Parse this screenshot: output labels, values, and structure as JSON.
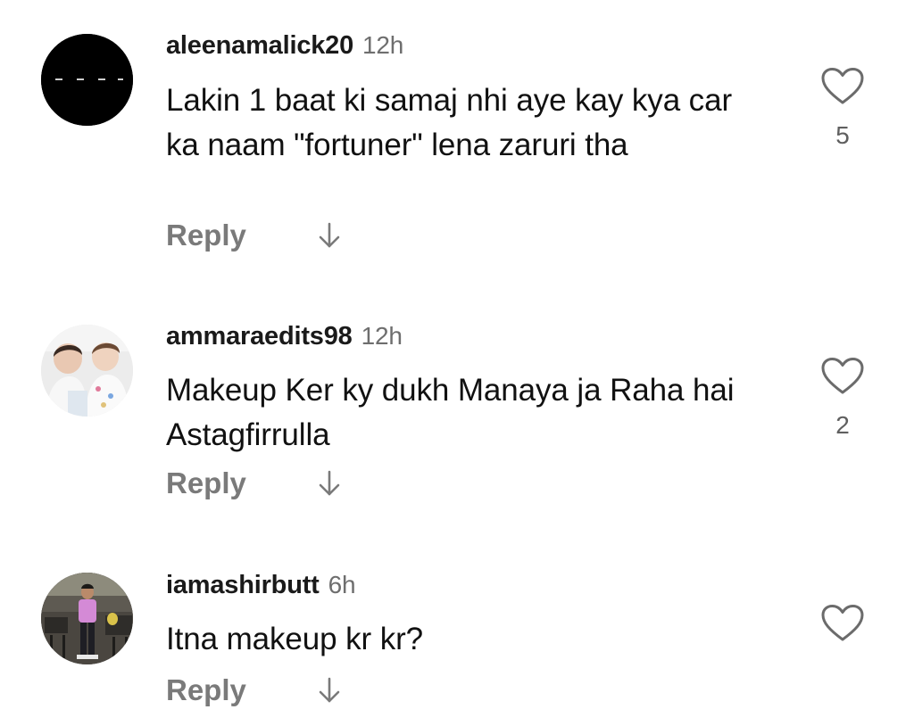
{
  "comments": [
    {
      "username": "aleenamalick20",
      "time": "12h",
      "text": "Lakin 1 baat ki samaj nhi aye kay kya car ka naam \"fortuner\" lena zaruri tha",
      "likes": "5",
      "reply_label": "Reply",
      "avatar": "black-circle-with-dashes"
    },
    {
      "username": "ammaraedits98",
      "time": "12h",
      "text": "Makeup Ker ky dukh Manaya ja Raha hai Astagfirrulla",
      "likes": "2",
      "reply_label": "Reply",
      "avatar": "two-children-photo"
    },
    {
      "username": "iamashirbutt",
      "time": "6h",
      "text": "Itna makeup kr kr?",
      "likes": "",
      "reply_label": "Reply",
      "avatar": "person-in-pink-shirt-photo"
    }
  ],
  "icons": {
    "like": "heart-outline-icon",
    "more_replies": "arrow-down-icon"
  },
  "colors": {
    "text": "#111111",
    "secondary": "#6e6e6e",
    "reply": "#7a7a7a"
  }
}
